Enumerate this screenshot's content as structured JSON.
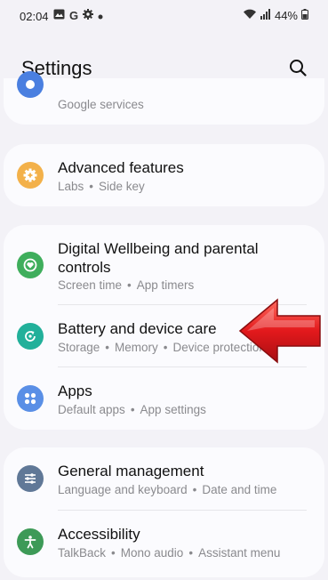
{
  "status": {
    "time": "02:04",
    "battery": "44%"
  },
  "header": {
    "title": "Settings"
  },
  "groups": [
    {
      "items": [
        {
          "title": "",
          "subtitle": "Google services",
          "icon": "google-icon",
          "color": "#4a7fe0"
        }
      ]
    },
    {
      "items": [
        {
          "title": "Advanced features",
          "subtitle_parts": [
            "Labs",
            "Side key"
          ],
          "icon": "gear-plus-icon",
          "color": "#f3b14a"
        }
      ]
    },
    {
      "items": [
        {
          "title": "Digital Wellbeing and parental controls",
          "title_line1": "Digital Wellbeing and parental",
          "title_line2": "controls",
          "subtitle_parts": [
            "Screen time",
            "App timers"
          ],
          "icon": "heart-circle-icon",
          "color": "#3fae5c"
        },
        {
          "title": "Battery and device care",
          "subtitle_parts": [
            "Storage",
            "Memory",
            "Device protection"
          ],
          "icon": "refresh-icon",
          "color": "#22b09a"
        },
        {
          "title": "Apps",
          "subtitle_parts": [
            "Default apps",
            "App settings"
          ],
          "icon": "apps-grid-icon",
          "color": "#5a8fe6"
        }
      ]
    },
    {
      "items": [
        {
          "title": "General management",
          "subtitle_parts": [
            "Language and keyboard",
            "Date and time"
          ],
          "icon": "sliders-icon",
          "color": "#607897"
        },
        {
          "title": "Accessibility",
          "subtitle_parts": [
            "TalkBack",
            "Mono audio",
            "Assistant menu"
          ],
          "icon": "accessibility-icon",
          "color": "#3d9a57"
        }
      ]
    }
  ],
  "colors": {
    "arrow": "#e3191c",
    "background": "#f3f2f7",
    "card": "#fbfbfe"
  }
}
